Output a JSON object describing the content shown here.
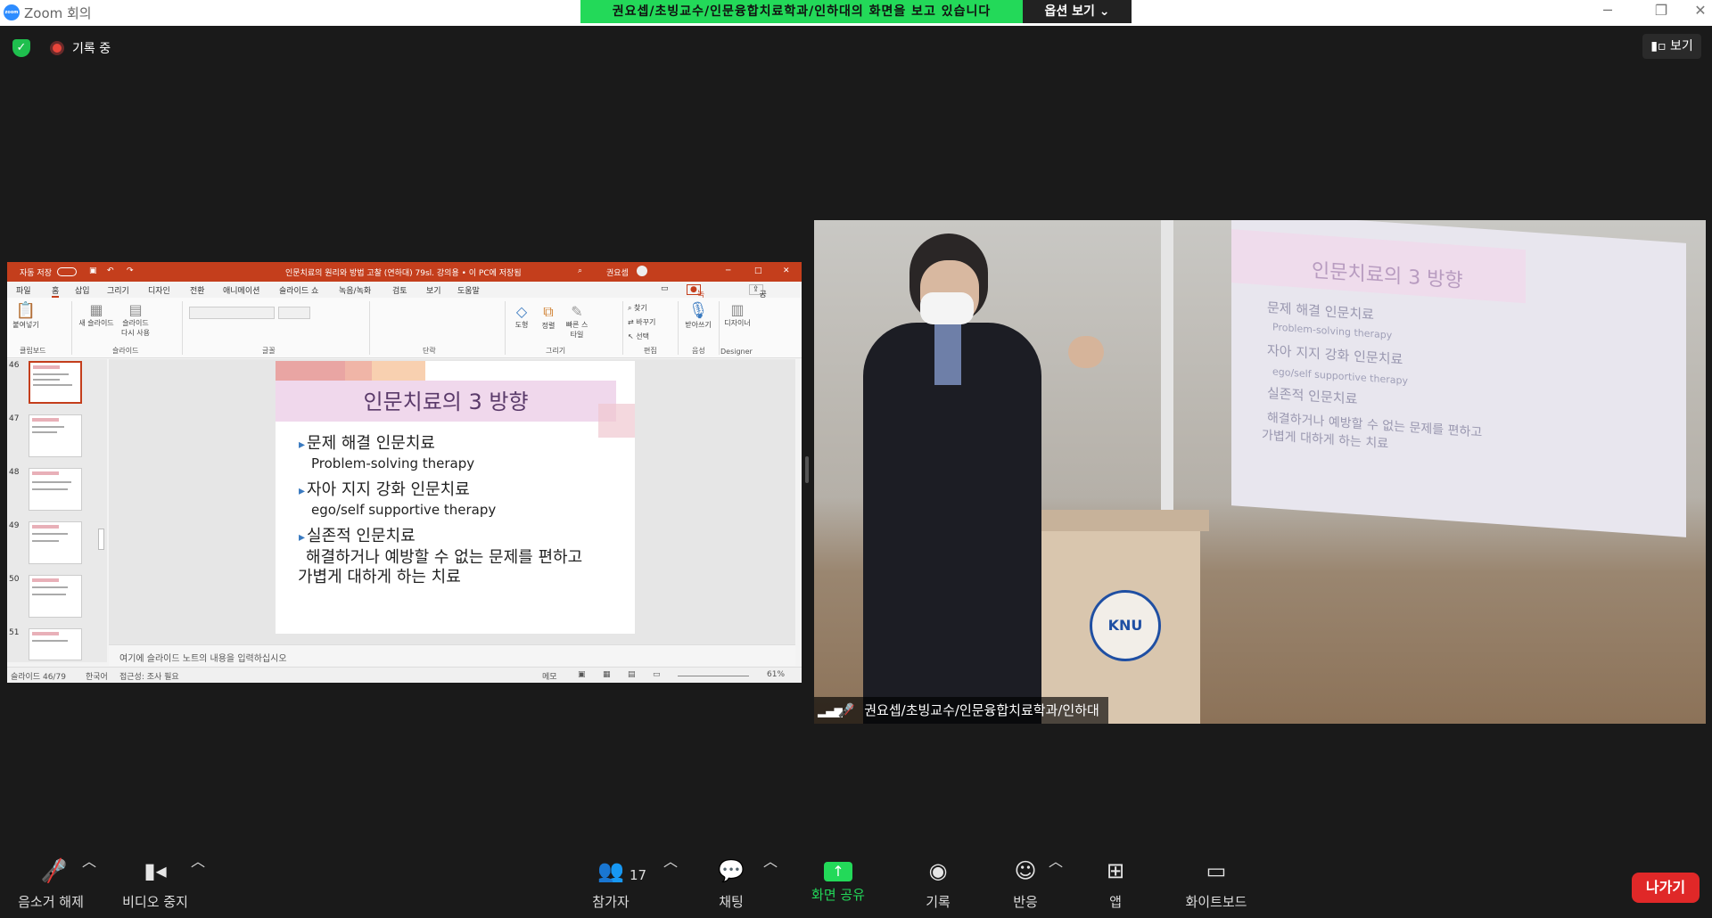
{
  "window": {
    "title": "Zoom 회의"
  },
  "share_banner": {
    "text": "권요셉/초빙교수/인문융합치료학과/인하대의 화면을 보고 있습니다",
    "options_label": "옵션 보기"
  },
  "top": {
    "recording_label": "기록 중",
    "view_label": "보기"
  },
  "ppt": {
    "autosave": "자동 저장",
    "title_text": "인문치료의 원리와 방법 고찰 (연하대) 79sl. 강의용 • 이 PC에 저장됨",
    "user": "권요셉",
    "menu": [
      "파일",
      "홈",
      "삽입",
      "그리기",
      "디자인",
      "전환",
      "애니메이션",
      "슬라이드 쇼",
      "녹음/녹화",
      "검토",
      "보기",
      "도움말"
    ],
    "record_btn": "녹음/녹화",
    "share_btn": "공유",
    "ribbon": {
      "paste": "붙여넣기",
      "new_slide": "새 슬라이드",
      "reuse_slide": "슬라이드 다시 사용",
      "shape": "도형",
      "arrange": "정렬",
      "quick_style": "빠른 스타일",
      "find": "찾기",
      "replace": "바꾸기",
      "select": "선택",
      "dictate": "받아쓰기",
      "designer": "디자이너",
      "groups": [
        "클립보드",
        "슬라이드",
        "글꼴",
        "단락",
        "그리기",
        "편집",
        "음성",
        "Designer"
      ]
    },
    "thumbnail_numbers": [
      "46",
      "47",
      "48",
      "49",
      "50",
      "51"
    ],
    "slide": {
      "title": "인문치료의 3 방향",
      "bullet1": "문제 해결 인문치료",
      "sub1": "Problem-solving therapy",
      "bullet2": "자아 지지 강화 인문치료",
      "sub2": "ego/self supportive therapy",
      "bullet3": "실존적 인문치료",
      "para_line1": "해결하거나 예방할 수 없는 문제를 편하고",
      "para_line2": "가볍게 대하게 하는 치료"
    },
    "notes_placeholder": "여기에 슬라이드 노트의 내용을 입력하십시오",
    "status": {
      "slide": "슬라이드 46/79",
      "lang": "한국어",
      "accessibility": "접근성: 조사 필요",
      "notes": "메모",
      "zoom": "61%"
    }
  },
  "video": {
    "name": "권요셉/초빙교수/인문융합치료학과/인하대",
    "emblem": "KNU",
    "screen_title": "인문치료의 3 방향",
    "screen_lines": [
      "문제 해결 인문치료",
      "Problem-solving therapy",
      "자아 지지 강화 인문치료",
      "ego/self supportive therapy",
      "실존적 인문치료",
      "해결하거나 예방할 수 없는 문제를 편하고",
      "가볍게 대하게 하는 치료"
    ]
  },
  "toolbar": {
    "mute": "음소거 해제",
    "video": "비디오 중지",
    "participants": "참가자",
    "participants_count": "17",
    "chat": "채팅",
    "share": "화면 공유",
    "record": "기록",
    "reactions": "반응",
    "apps": "앱",
    "whiteboard": "화이트보드",
    "leave": "나가기"
  },
  "colors": {
    "share_green": "#23d959",
    "leave_red": "#e02828",
    "ppt_red": "#c43e1c"
  }
}
